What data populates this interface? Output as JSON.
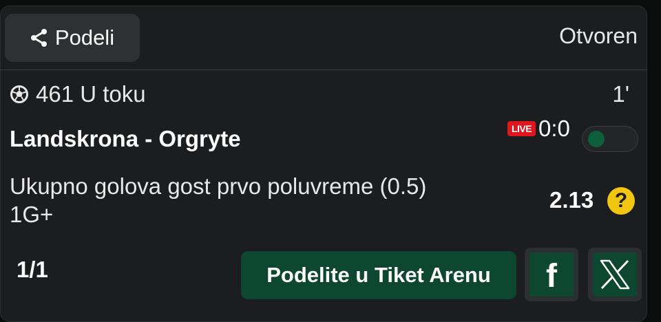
{
  "header": {
    "share_label": "Podeli",
    "status": "Otvoren"
  },
  "event": {
    "code_and_state": "461 U toku",
    "minute": "1'",
    "teams": "Landskrona - Orgryte",
    "live_badge": "LIVE",
    "score": "0:0"
  },
  "bet": {
    "market_line1": "Ukupno golova gost prvo poluvreme (0.5)",
    "market_line2": "1G+",
    "odds": "2.13",
    "help_glyph": "?"
  },
  "footer": {
    "pager": "1/1",
    "arena_button": "Podelite u Tiket Arenu",
    "facebook_glyph": "f"
  },
  "icons": {
    "share": "share-icon",
    "sport": "soccer-ball-icon",
    "facebook": "facebook-icon",
    "x": "x-twitter-icon",
    "help": "question-icon"
  },
  "colors": {
    "accent_green": "#0e4731",
    "live_red": "#e0161e",
    "help_yellow": "#f2c511",
    "card_bg": "#1c1d1e"
  }
}
